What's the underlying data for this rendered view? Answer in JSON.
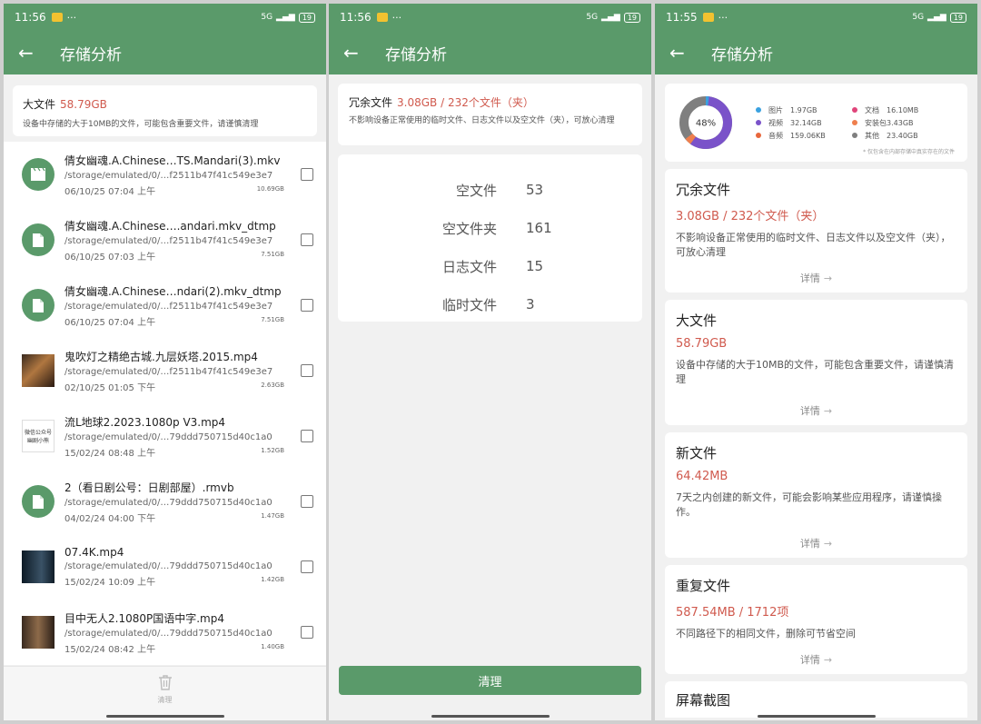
{
  "colors": {
    "primary": "#5a9a6a",
    "accent": "#d05a4e"
  },
  "status_bars": [
    {
      "time": "11:56",
      "network": "5G",
      "battery": "19"
    },
    {
      "time": "11:56",
      "network": "5G",
      "battery": "19"
    },
    {
      "time": "11:55",
      "network": "5G",
      "battery": "19"
    }
  ],
  "app_title": "存储分析",
  "large_files": {
    "label": "大文件",
    "size": "58.79GB",
    "description": "设备中存储的大于10MB的文件，可能包含重要文件，请谨慎清理",
    "files": [
      {
        "icon": "video-file-icon",
        "name": "倩女幽魂.A.Chinese…TS.Mandari(3).mkv",
        "path": "/storage/emulated/0/…f2511b47f41c549e3e7",
        "date": "06/10/25 07:04 上午",
        "size": "10.69GB"
      },
      {
        "icon": "document-file-icon",
        "name": "倩女幽魂.A.Chinese….andari.mkv_dtmp",
        "path": "/storage/emulated/0/…f2511b47f41c549e3e7",
        "date": "06/10/25 07:03 上午",
        "size": "7.51GB"
      },
      {
        "icon": "document-file-icon",
        "name": "倩女幽魂.A.Chinese…ndari(2).mkv_dtmp",
        "path": "/storage/emulated/0/…f2511b47f41c549e3e7",
        "date": "06/10/25 07:04 上午",
        "size": "7.51GB"
      },
      {
        "icon": "thumbnail",
        "name": "鬼吹灯之精绝古城.九层妖塔.2015.mp4",
        "path": "/storage/emulated/0/…f2511b47f41c549e3e7",
        "date": "02/10/25 01:05 下午",
        "size": "2.63GB"
      },
      {
        "icon": "thumbnail",
        "name": "流L地球2.2023.1080p V3.mp4",
        "path": "/storage/emulated/0/…79ddd750715d40c1a0",
        "date": "15/02/24 08:48 上午",
        "size": "1.52GB",
        "thumb_text": [
          "微信公众号",
          "幽剧小熊"
        ]
      },
      {
        "icon": "document-file-icon",
        "name": "2（看日剧公号：日剧部屋）.rmvb",
        "path": "/storage/emulated/0/…79ddd750715d40c1a0",
        "date": "04/02/24 04:00 下午",
        "size": "1.47GB"
      },
      {
        "icon": "thumbnail",
        "name": "07.4K.mp4",
        "path": "/storage/emulated/0/…79ddd750715d40c1a0",
        "date": "15/02/24 10:09 上午",
        "size": "1.42GB"
      },
      {
        "icon": "thumbnail",
        "name": "目中无人2.1080P国语中字.mp4",
        "path": "/storage/emulated/0/…79ddd750715d40c1a0",
        "date": "15/02/24 08:42 上午",
        "size": "1.40GB"
      }
    ],
    "clean_label": "清理"
  },
  "redundant": {
    "label": "冗余文件",
    "size": "3.08GB / 232个文件（夹）",
    "description": "不影响设备正常使用的临时文件、日志文件以及空文件（夹），可放心清理",
    "stats": [
      {
        "label": "空文件",
        "value": "53"
      },
      {
        "label": "空文件夹",
        "value": "161"
      },
      {
        "label": "日志文件",
        "value": "15"
      },
      {
        "label": "临时文件",
        "value": "3"
      }
    ],
    "clean_label": "清理"
  },
  "overview": {
    "donut_percent": "48%",
    "legend": [
      {
        "name": "图片",
        "value": "1.97GB",
        "color": "#3aa1e0"
      },
      {
        "name": "文档",
        "value": "16.10MB",
        "color": "#e0457a"
      },
      {
        "name": "视频",
        "value": "32.14GB",
        "color": "#7a52c9"
      },
      {
        "name": "安装包",
        "value": "3.43GB",
        "color": "#ef7f4d"
      },
      {
        "name": "音频",
        "value": "159.06KB",
        "color": "#e8673c"
      },
      {
        "name": "其他",
        "value": "23.40GB",
        "color": "#7f7f7f"
      }
    ],
    "note": "* 仅包含在内部存储中真实存在的文件",
    "categories": [
      {
        "title": "冗余文件",
        "size": "3.08GB / 232个文件（夹）",
        "description": "不影响设备正常使用的临时文件、日志文件以及空文件（夹），可放心清理"
      },
      {
        "title": "大文件",
        "size": "58.79GB",
        "description": "设备中存储的大于10MB的文件，可能包含重要文件，请谨慎清理"
      },
      {
        "title": "新文件",
        "size": "64.42MB",
        "description": "7天之内创建的新文件，可能会影响某些应用程序，请谨慎操作。"
      },
      {
        "title": "重复文件",
        "size": "587.54MB / 1712项",
        "description": "不同路径下的相同文件，删除可节省空间"
      }
    ],
    "detail_label": "详情",
    "next_title": "屏幕截图"
  }
}
